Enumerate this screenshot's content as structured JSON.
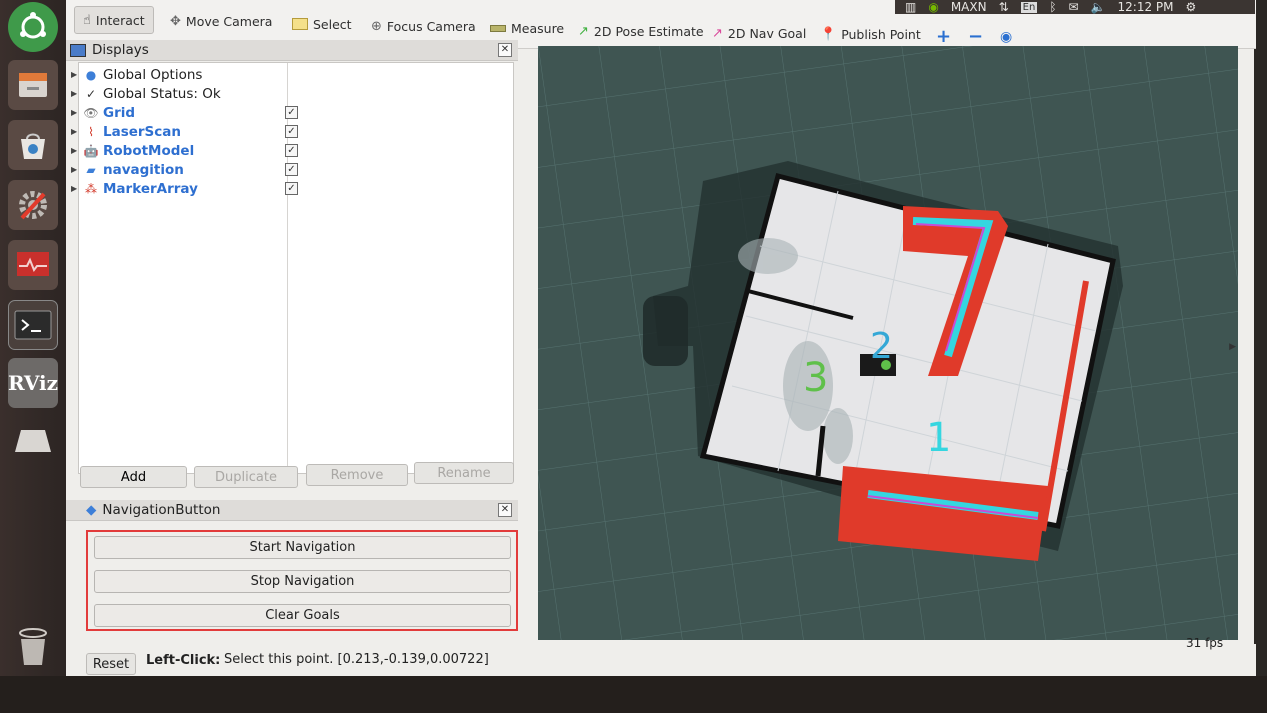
{
  "toolbar": {
    "interact": "Interact",
    "move_camera": "Move Camera",
    "select": "Select",
    "focus_camera": "Focus Camera",
    "measure": "Measure",
    "pose_estimate": "2D Pose Estimate",
    "nav_goal": "2D Nav Goal",
    "publish_point": "Publish Point"
  },
  "system_tray": {
    "power_mode": "MAXN",
    "keyboard": "En",
    "time": "12:12 PM"
  },
  "displays": {
    "title": "Displays",
    "items": [
      {
        "label": "Global Options",
        "checked": null
      },
      {
        "label": "Global Status: Ok",
        "checked": null
      },
      {
        "label": "Grid",
        "checked": true
      },
      {
        "label": "LaserScan",
        "checked": true
      },
      {
        "label": "RobotModel",
        "checked": true
      },
      {
        "label": "navagition",
        "checked": true
      },
      {
        "label": "MarkerArray",
        "checked": true
      }
    ],
    "buttons": {
      "add": "Add",
      "duplicate": "Duplicate",
      "remove": "Remove",
      "rename": "Rename"
    }
  },
  "navigation_panel": {
    "title": "NavigationButton",
    "start": "Start Navigation",
    "stop": "Stop Navigation",
    "clear": "Clear Goals"
  },
  "status_bar": {
    "reset": "Reset",
    "hint_bold": "Left-Click:",
    "hint_text": "Select this point. [0.213,-0.139,0.00722]",
    "fps": "31 fps"
  },
  "map": {
    "markers": [
      "1",
      "2",
      "3"
    ],
    "shape_label": "7"
  },
  "colors": {
    "accent_red": "#e23b3b",
    "map_bg": "#3f5552",
    "cyan": "#35d6e0",
    "green": "#5fc04a"
  }
}
